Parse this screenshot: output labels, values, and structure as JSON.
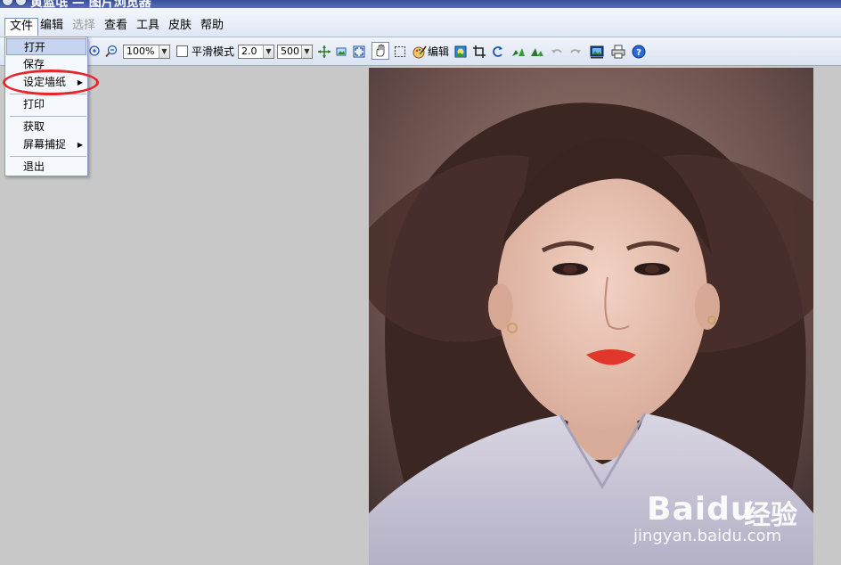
{
  "titlebar": {
    "text": "黄蓝氓 — 图片浏览器"
  },
  "menubar": {
    "items": [
      {
        "label": "文件",
        "active": true
      },
      {
        "label": "编辑"
      },
      {
        "label": "选择",
        "disabled": true
      },
      {
        "label": "查看"
      },
      {
        "label": "工具"
      },
      {
        "label": "皮肤"
      },
      {
        "label": "帮助"
      }
    ]
  },
  "toolbar": {
    "zoom_value": "100%",
    "smooth_label": "平滑模式",
    "ratio_value": "2.0",
    "size_value": "500",
    "edit_label": "编辑"
  },
  "file_menu": {
    "items": [
      {
        "label": "打开",
        "highlighted": true
      },
      {
        "label": "保存"
      },
      {
        "label": "设定墙纸",
        "submenu": true
      },
      {
        "label": "打印"
      },
      {
        "label": "获取"
      },
      {
        "label": "屏幕捕捉",
        "submenu": true
      },
      {
        "label": "退出"
      }
    ]
  },
  "watermark": {
    "logo": "Baidu",
    "cn": "经验",
    "url": "jingyan.baidu.com"
  },
  "colors": {
    "highlight_ring": "#e8242c",
    "menu_highlight": "#c6d4ef"
  }
}
